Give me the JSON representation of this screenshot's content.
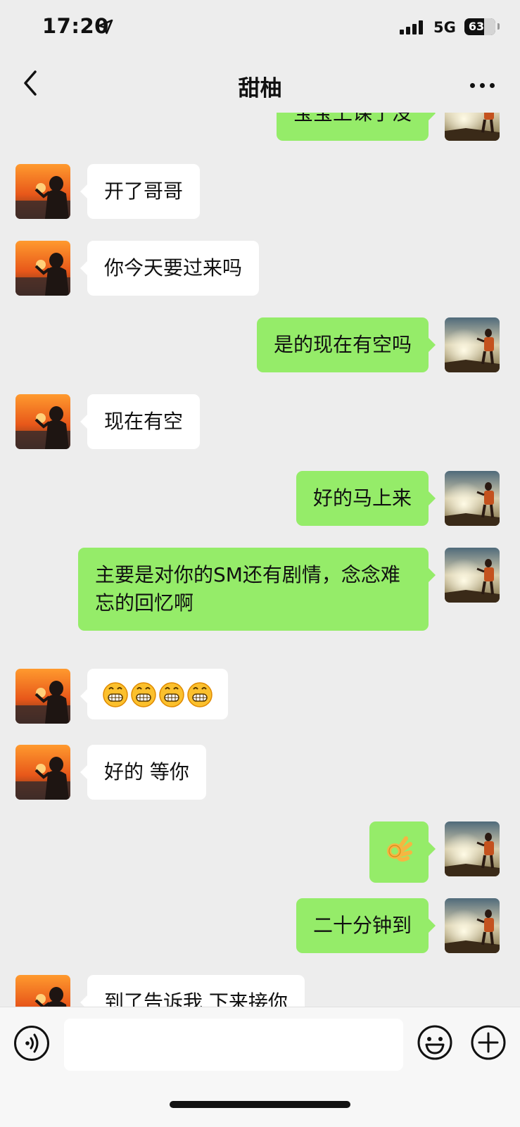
{
  "status": {
    "time": "17:20",
    "network": "5G",
    "battery": "63"
  },
  "header": {
    "title": "甜柚"
  },
  "messages": [
    {
      "side": "right",
      "text": "宝宝上课了没"
    },
    {
      "side": "left",
      "text": "开了哥哥"
    },
    {
      "side": "left",
      "text": "你今天要过来吗"
    },
    {
      "side": "right",
      "text": "是的现在有空吗"
    },
    {
      "side": "left",
      "text": "现在有空"
    },
    {
      "side": "right",
      "text": "好的马上来"
    },
    {
      "side": "right",
      "text": "主要是对你的SM还有剧情，念念难忘的回忆啊"
    },
    {
      "side": "left",
      "text": "😁😁😁😁"
    },
    {
      "side": "left",
      "text": "好的 等你"
    },
    {
      "side": "right",
      "text": "👌"
    },
    {
      "side": "right",
      "text": "二十分钟到"
    },
    {
      "side": "left",
      "text": "到了告诉我 下来接你"
    }
  ],
  "input": {
    "value": ""
  },
  "icons": {
    "back": "chevron-left-icon",
    "more": "more-dots-icon",
    "voice": "voice-icon",
    "emoji": "emoji-icon",
    "plus": "plus-icon",
    "location": "location-arrow-icon"
  },
  "colors": {
    "background": "#ededed",
    "bubble_self": "#95ec69",
    "bubble_other": "#ffffff",
    "input_bar": "#f7f7f7"
  }
}
